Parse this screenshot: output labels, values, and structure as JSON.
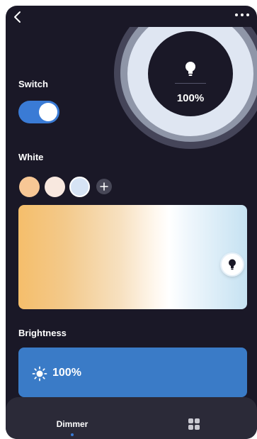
{
  "nav": {
    "back_icon": "chevron-left-icon",
    "more_icon": "more-dots-icon"
  },
  "lamp": {
    "icon": "bulb-icon",
    "brightness_label": "100%"
  },
  "switch": {
    "label": "Switch",
    "on": true,
    "color": "#3a7bd5"
  },
  "white": {
    "label": "White",
    "swatches": [
      {
        "color": "#f7c795",
        "selected": false
      },
      {
        "color": "#f8e8df",
        "selected": false
      },
      {
        "color": "#d6e3f4",
        "selected": true
      }
    ],
    "add_icon": "plus-icon",
    "temperature_position": 0.92
  },
  "brightness": {
    "label": "Brightness",
    "value_label": "100%",
    "icon": "sun-icon",
    "color": "#3a7bc7"
  },
  "tabs": [
    {
      "label": "Dimmer",
      "active": true
    },
    {
      "label": "",
      "icon": "grid-icon",
      "active": false
    }
  ]
}
